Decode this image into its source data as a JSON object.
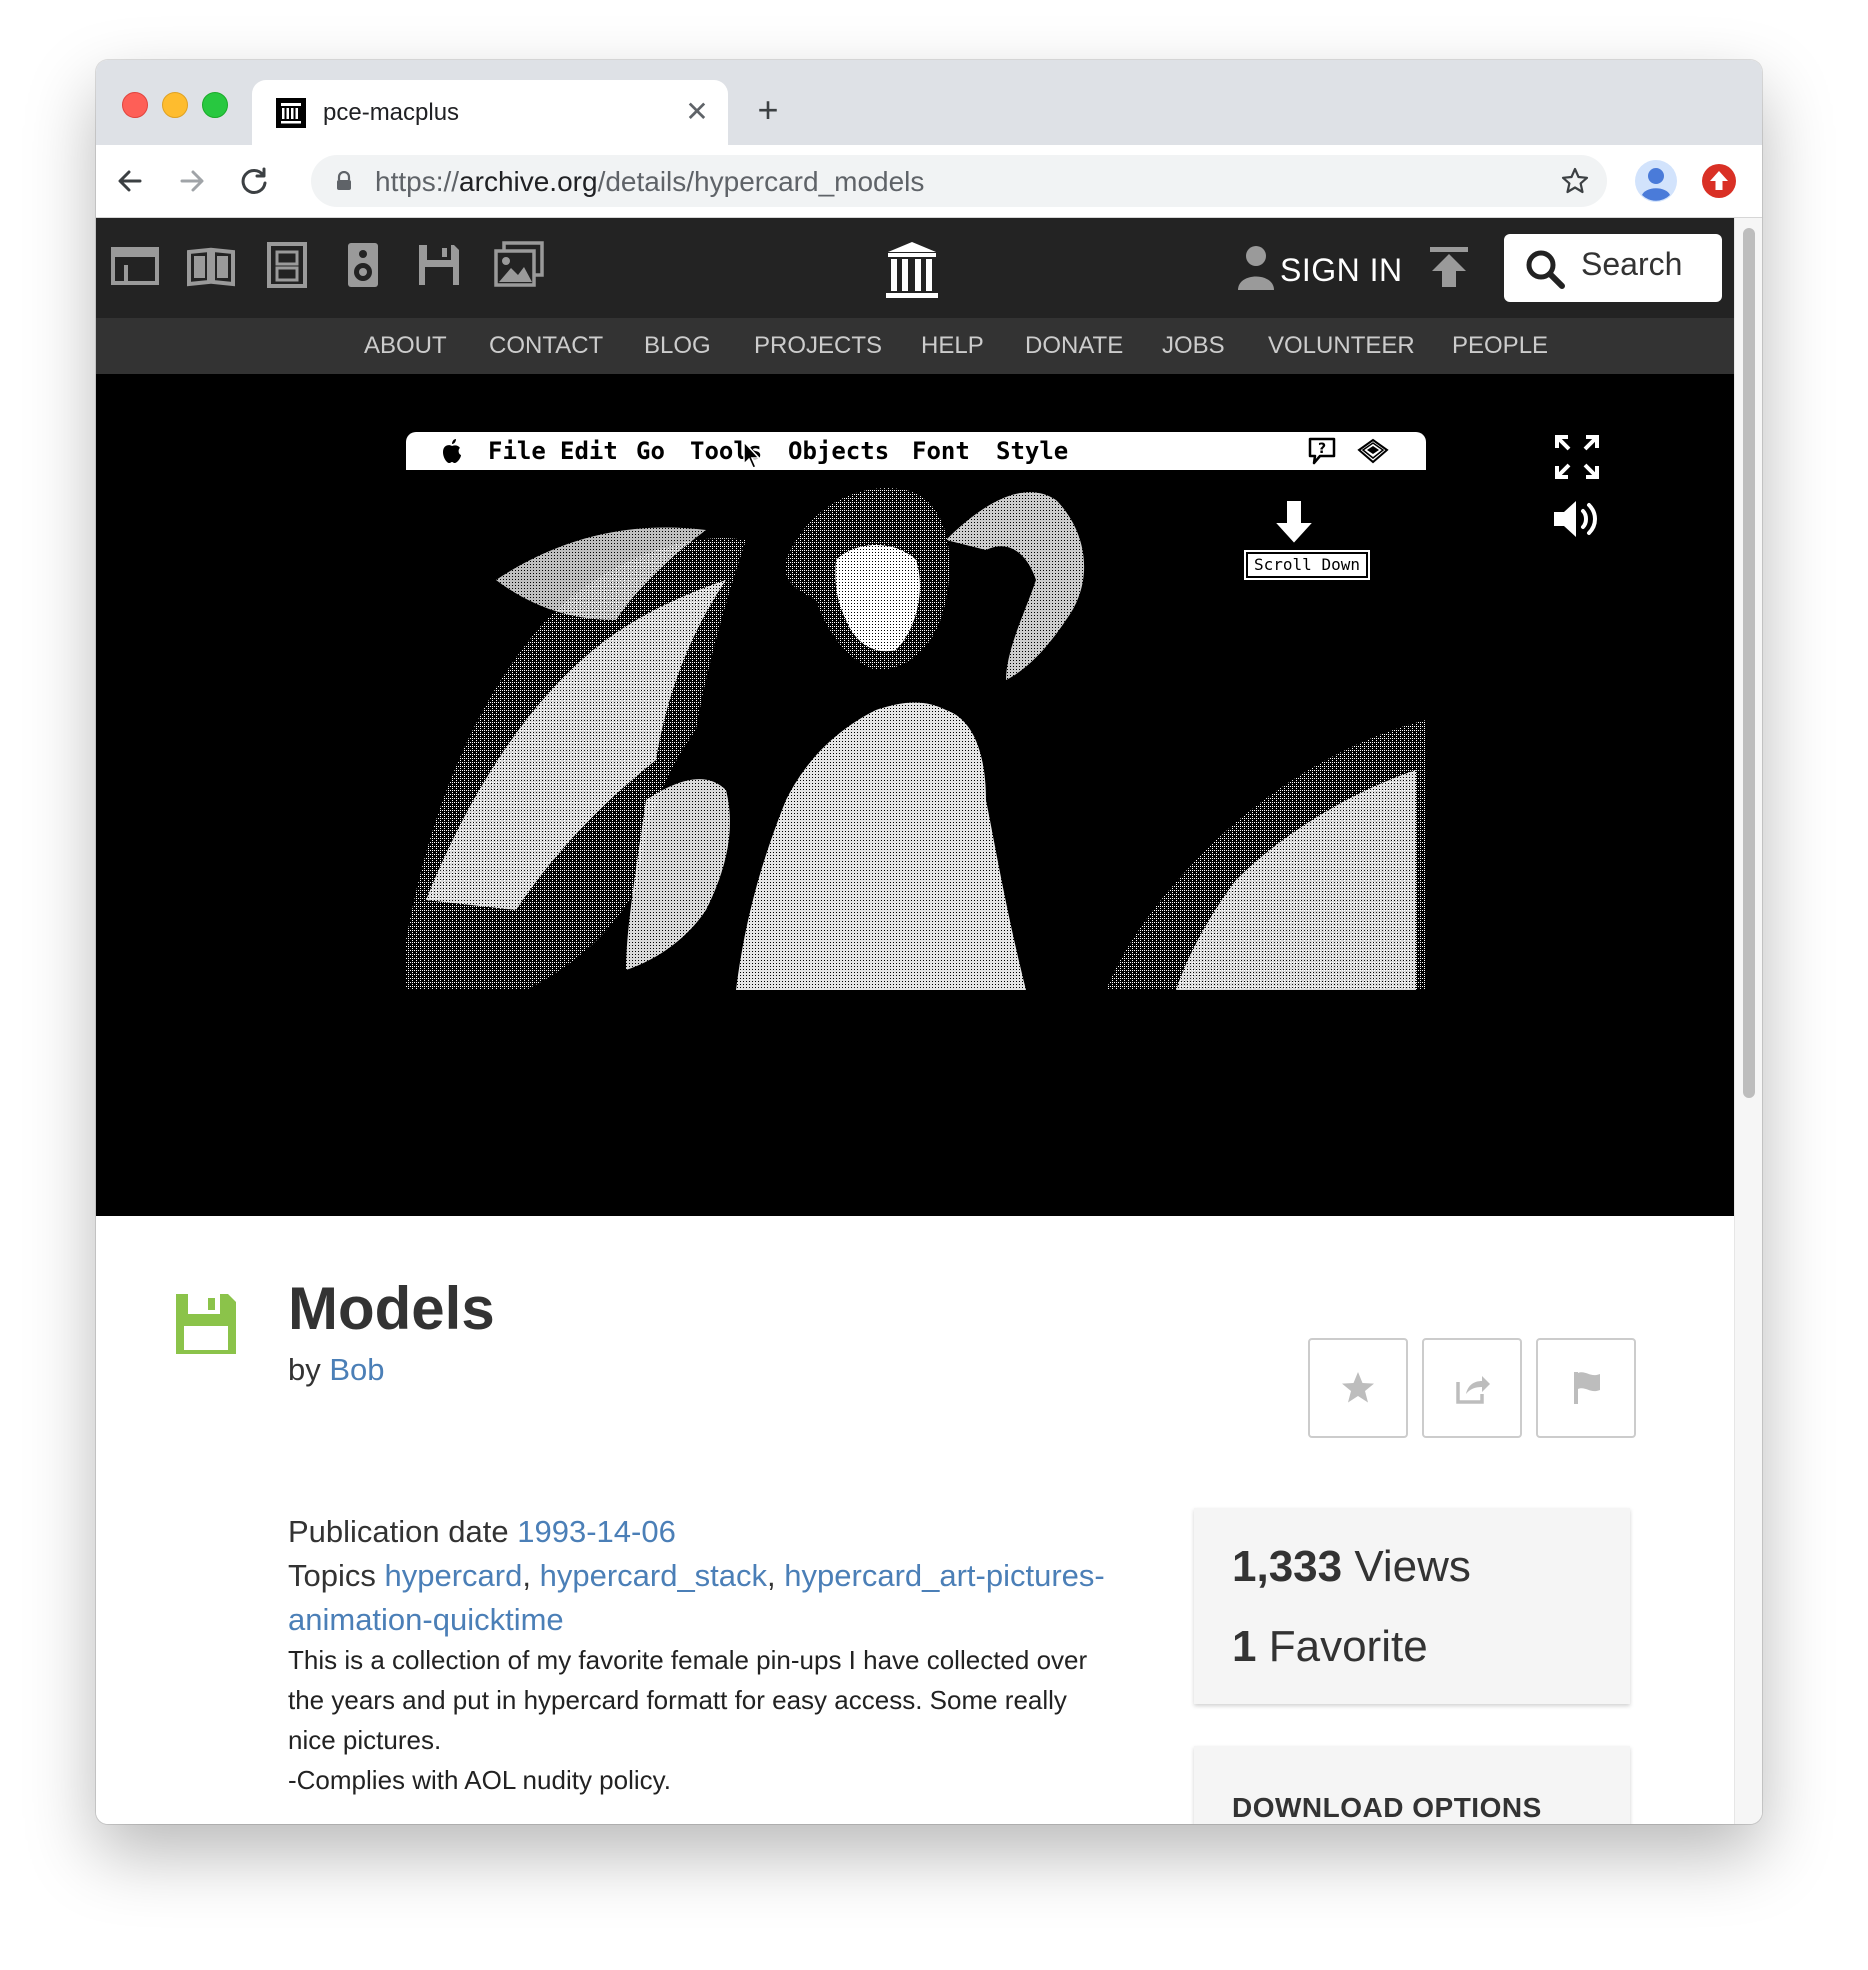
{
  "browser": {
    "tab_title": "pce-macplus",
    "new_tab_symbol": "+",
    "close_tab_symbol": "✕",
    "url_scheme": "https://",
    "url_host": "archive.org",
    "url_path": "/details/hypercard_models"
  },
  "site": {
    "sign_in_label": "SIGN IN",
    "search_label": "Search",
    "media_icons": [
      "web-icon",
      "texts-icon",
      "video-icon",
      "audio-icon",
      "software-icon",
      "images-icon"
    ],
    "subnav": [
      "ABOUT",
      "CONTACT",
      "BLOG",
      "PROJECTS",
      "HELP",
      "DONATE",
      "JOBS",
      "VOLUNTEER",
      "PEOPLE"
    ]
  },
  "emulator": {
    "menu_items": [
      "File",
      "Edit",
      "Go",
      "Tools",
      "Objects",
      "Font",
      "Style"
    ],
    "scroll_down_label": "Scroll Down"
  },
  "item": {
    "title": "Models",
    "by_prefix": "by",
    "creator": "Bob",
    "pub_date_label": "Publication date",
    "pub_date": "1993-14-06",
    "topics_label": "Topics",
    "topics": [
      "hypercard",
      "hypercard_stack",
      "hypercard_art-pictures-"
    ],
    "topic_continuation": "animation-quicktime",
    "description_lines": [
      "This is a collection of my favorite female pin-ups I have collected over",
      "the years and put in hypercard formatt for easy access. Some really",
      "nice pictures.",
      "-Complies with AOL nudity policy."
    ]
  },
  "stats": {
    "views_count": "1,333",
    "views_label": "Views",
    "favorites_count": "1",
    "favorites_label": "Favorite"
  },
  "download": {
    "title": "DOWNLOAD OPTIONS"
  },
  "colors": {
    "link": "#4b7fb7",
    "nav_dark": "#232323",
    "subnav": "#333333",
    "software_icon": "#8bc34a"
  }
}
